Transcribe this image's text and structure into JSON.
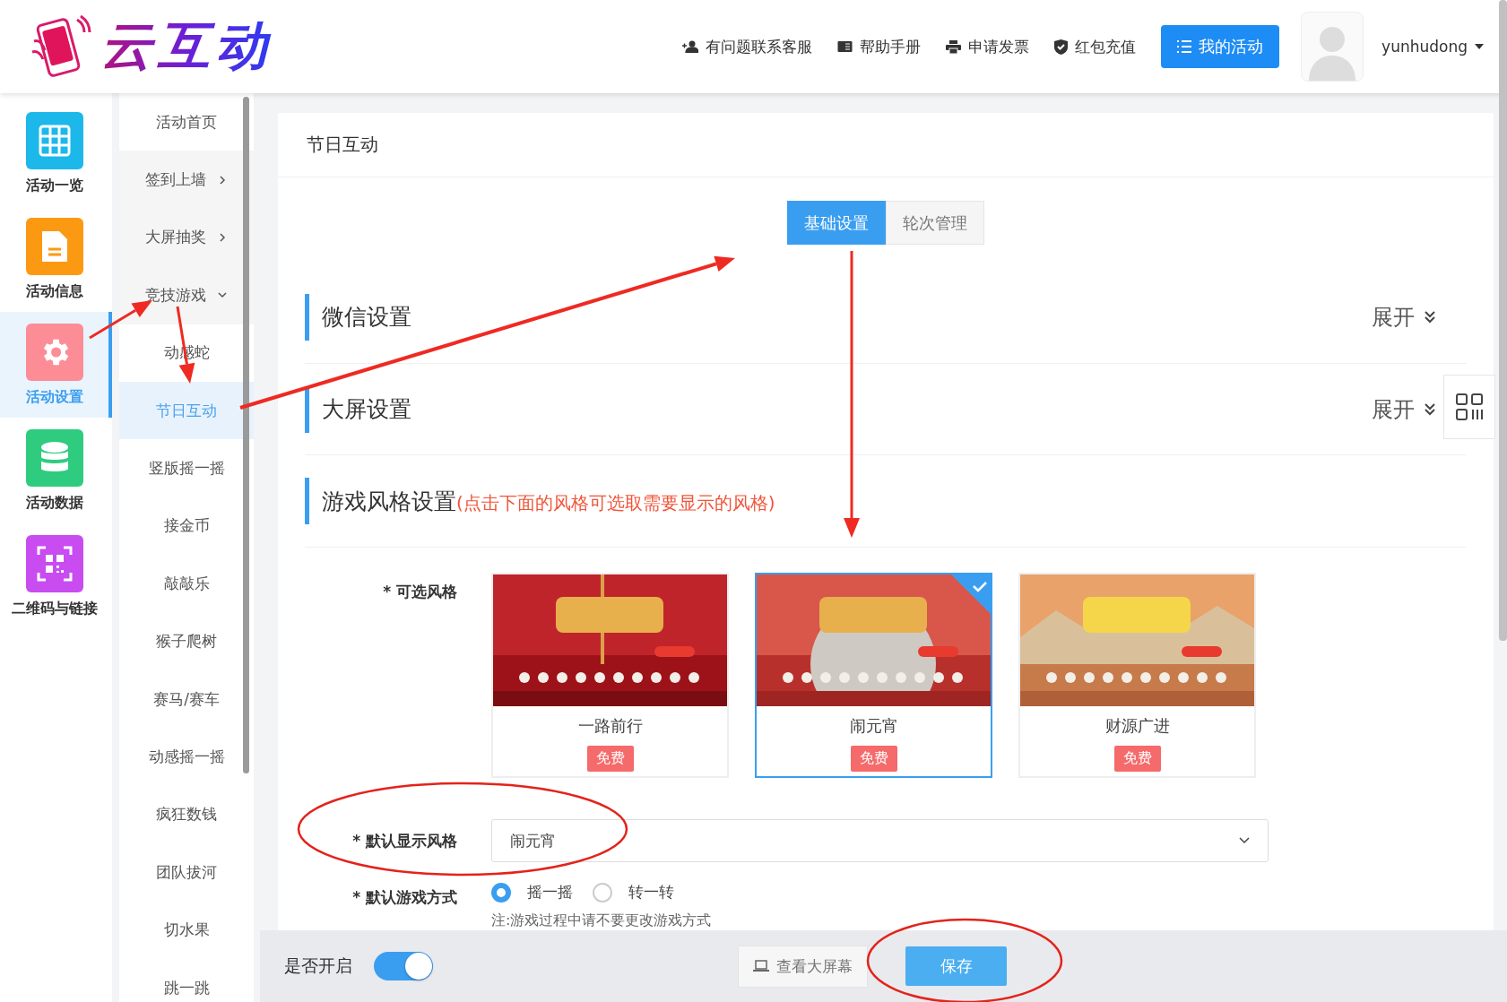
{
  "header": {
    "logo_text": "云互动",
    "links": [
      "有问题联系客服",
      "帮助手册",
      "申请发票",
      "红包充值"
    ],
    "primary_button": "我的活动",
    "username": "yunhudong"
  },
  "nav": [
    {
      "label": "活动一览",
      "color": "#1cb8ea",
      "selected": false
    },
    {
      "label": "活动信息",
      "color": "#fb9a12",
      "selected": false
    },
    {
      "label": "活动设置",
      "color": "#fc8d97",
      "selected": true
    },
    {
      "label": "活动数据",
      "color": "#2fcc7f",
      "selected": false
    },
    {
      "label": "二维码与链接",
      "color": "#c84cf0",
      "selected": false
    }
  ],
  "submenu": [
    {
      "label": "活动首页",
      "kind": "link",
      "selected": false
    },
    {
      "label": "签到上墙",
      "kind": "group",
      "expanded": false
    },
    {
      "label": "大屏抽奖",
      "kind": "group",
      "expanded": false
    },
    {
      "label": "竞技游戏",
      "kind": "group",
      "expanded": true,
      "children": [
        {
          "label": "动感蛇",
          "selected": false
        },
        {
          "label": "节日互动",
          "selected": true
        },
        {
          "label": "竖版摇一摇",
          "selected": false
        },
        {
          "label": "接金币",
          "selected": false
        },
        {
          "label": "敲敲乐",
          "selected": false
        },
        {
          "label": "猴子爬树",
          "selected": false
        },
        {
          "label": "赛马/赛车",
          "selected": false
        },
        {
          "label": "动感摇一摇",
          "selected": false
        },
        {
          "label": "疯狂数钱",
          "selected": false
        },
        {
          "label": "团队拔河",
          "selected": false
        },
        {
          "label": "切水果",
          "selected": false
        },
        {
          "label": "跳一跳",
          "selected": false
        }
      ]
    }
  ],
  "page": {
    "title": "节日互动",
    "tabs": [
      {
        "label": "基础设置",
        "selected": true
      },
      {
        "label": "轮次管理",
        "selected": false
      }
    ],
    "sections": [
      {
        "title": "微信设置",
        "toggle": "展开"
      },
      {
        "title": "大屏设置",
        "toggle": "展开"
      }
    ],
    "style_section": {
      "title": "游戏风格设置",
      "hint": "(点击下面的风格可选取需要显示的风格)",
      "label": "* 可选风格",
      "styles": [
        {
          "name": "一路前行",
          "badge": "免费",
          "selected": false
        },
        {
          "name": "闹元宵",
          "badge": "免费",
          "selected": true
        },
        {
          "name": "财源广进",
          "badge": "免费",
          "selected": false
        }
      ]
    },
    "default_style": {
      "label": "* 默认显示风格",
      "value": "闹元宵"
    },
    "game_mode": {
      "label": "* 默认游戏方式",
      "options": [
        {
          "label": "摇一摇",
          "selected": true
        },
        {
          "label": "转一转",
          "selected": false
        }
      ],
      "note": "注:游戏过程中请不要更改游戏方式"
    }
  },
  "footer": {
    "enable_label": "是否开启",
    "enabled": true,
    "preview_button": "查看大屏幕",
    "save_button": "保存"
  },
  "annotations": [
    {
      "kind": "arrow"
    },
    {
      "kind": "arrow"
    },
    {
      "kind": "arrow"
    },
    {
      "kind": "arrow"
    },
    {
      "kind": "ellipse"
    },
    {
      "kind": "ellipse"
    }
  ]
}
